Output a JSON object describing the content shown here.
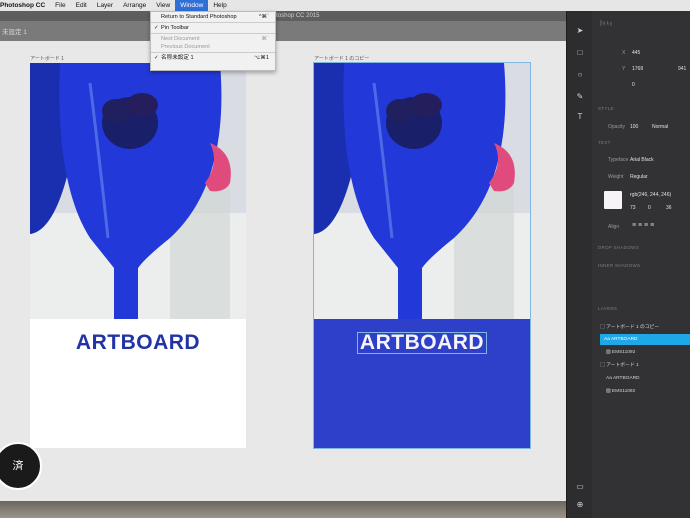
{
  "menubar": {
    "app_name": "Photoshop CC",
    "items": [
      "File",
      "Edit",
      "Layer",
      "Arrange",
      "View",
      "Window",
      "Help"
    ],
    "active": "Window"
  },
  "window": {
    "title": "Adobe Photoshop CC 2015",
    "tab_name": "未設定 1"
  },
  "window_menu": {
    "items": [
      {
        "label": "Return to Standard Photoshop",
        "shortcut": "^⌘`",
        "enabled": true,
        "checked": false
      },
      {
        "label": "Pin Toolbar",
        "shortcut": "",
        "enabled": true,
        "checked": true
      },
      {
        "label": "Next Document",
        "shortcut": "⌘`",
        "enabled": false,
        "checked": false
      },
      {
        "label": "Previous Document",
        "shortcut": "",
        "enabled": false,
        "checked": false
      },
      {
        "label": "名称未設定 1",
        "shortcut": "⌥⌘1",
        "enabled": true,
        "checked": true
      }
    ]
  },
  "artboards": [
    {
      "label": "アートボード 1",
      "text": "ARTBOARD",
      "bg": "#ffffff",
      "text_color": "#2233a6"
    },
    {
      "label": "アートボード 1 のコピー",
      "text": "ARTBOARD",
      "bg": "#2e3fc9",
      "text_color": "#f6f4f6"
    }
  ],
  "properties": {
    "x": "445",
    "y": "1768",
    "w": "941",
    "rotate": "0",
    "style_header": "STYLE",
    "opacity_label": "Opacity",
    "opacity": "100",
    "blend": "Normal",
    "text_header": "TEXT",
    "typeface_label": "Typeface",
    "typeface": "Arial Black",
    "weight_label": "Weight",
    "weight": "Regular",
    "color": "rgb(246, 244, 246)",
    "color_hex": "#f6f4f6",
    "size": "73",
    "leading": "0",
    "tracking": "36",
    "align_label": "Align",
    "drop_shadow": "DROP SHADOWS",
    "inner_shadows": "INNER SHADOWS",
    "layers_header": "LAYERS"
  },
  "layers": [
    {
      "name": "アートボード 1 のコピー",
      "kind": "artboard",
      "selected": false
    },
    {
      "name": "ARTBOARD",
      "kind": "text",
      "selected": true
    },
    {
      "name": "EMS11092",
      "kind": "image",
      "selected": false
    },
    {
      "name": "アートボード 1",
      "kind": "artboard",
      "selected": false
    },
    {
      "name": "ARTBOARD",
      "kind": "text",
      "selected": false
    },
    {
      "name": "EMS11092",
      "kind": "image",
      "selected": false
    }
  ],
  "badge": "済"
}
